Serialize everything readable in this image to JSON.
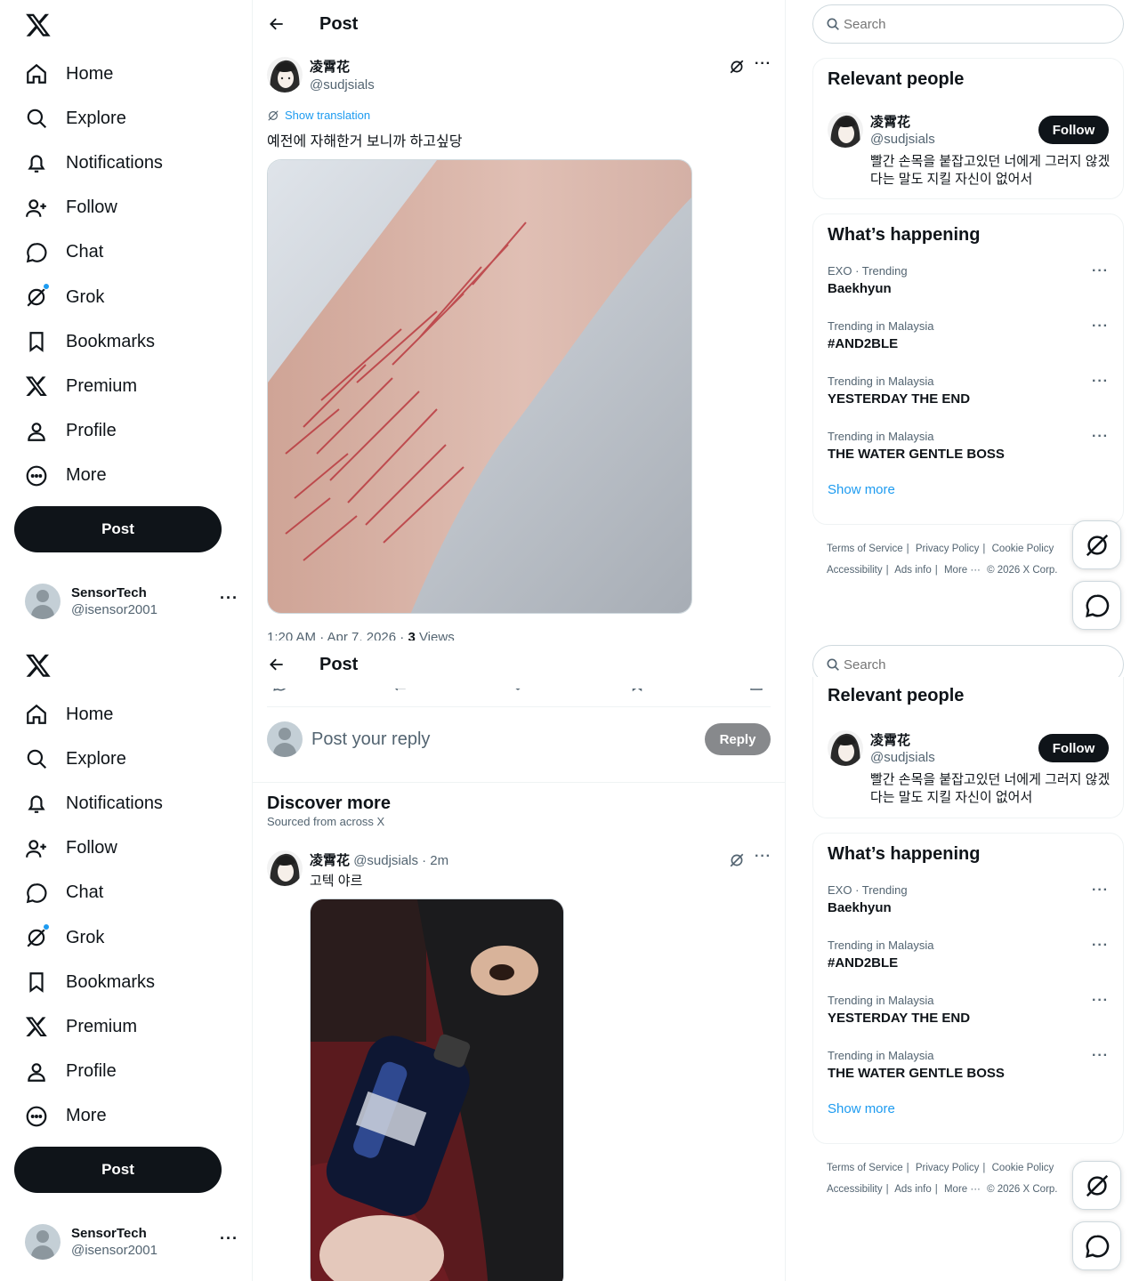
{
  "nav": {
    "items": [
      {
        "label": "Home"
      },
      {
        "label": "Explore"
      },
      {
        "label": "Notifications"
      },
      {
        "label": "Follow"
      },
      {
        "label": "Chat"
      },
      {
        "label": "Grok"
      },
      {
        "label": "Bookmarks"
      },
      {
        "label": "Premium"
      },
      {
        "label": "Profile"
      },
      {
        "label": "More"
      }
    ],
    "post_button": "Post"
  },
  "account": {
    "name": "SensorTech",
    "handle": "@isensor2001",
    "more": "···"
  },
  "header": {
    "title": "Post"
  },
  "post": {
    "author_name": "凌霄花",
    "author_handle": "@sudjsials",
    "show_translation": "Show translation",
    "text": "예전에 자해한거 보니까 하고싶당",
    "image_alt": "photo of a forearm with red scratches",
    "meta_time": "1:20 AM · Apr 7, 2026 · ",
    "meta_views": "3",
    "meta_views_label": " Views"
  },
  "reply": {
    "placeholder": "Post your reply",
    "button": "Reply"
  },
  "discover": {
    "title": "Discover more",
    "subtitle": "Sourced from across X",
    "post": {
      "author_name": "凌霄花",
      "author_handle": "@sudjsials",
      "time": "· 2m",
      "text": "고텍 야르"
    }
  },
  "search": {
    "placeholder": "Search"
  },
  "relevant": {
    "title": "Relevant people",
    "name": "凌霄花",
    "handle": "@sudjsials",
    "follow": "Follow",
    "bio": "빨간 손목을 붙잡고있던 너에게 그러지 않겠다는 말도 지킬 자신이 없어서"
  },
  "happening": {
    "title": "What’s happening",
    "trends": [
      {
        "category": "EXO · Trending",
        "name": "Baekhyun"
      },
      {
        "category": "Trending in Malaysia",
        "name": "#AND2BLE"
      },
      {
        "category": "Trending in Malaysia",
        "name": "YESTERDAY THE END"
      },
      {
        "category": "Trending in Malaysia",
        "name": "THE WATER GENTLE BOSS"
      }
    ],
    "show_more": "Show more"
  },
  "footer": {
    "tos": "Terms of Service",
    "privacy": "Privacy Policy",
    "cookie": "Cookie Policy",
    "accessibility": "Accessibility",
    "ads": "Ads info",
    "more": "More ···",
    "copyright": "© 2026 X Corp."
  },
  "colors": {
    "accent": "#1d9bf0",
    "text": "#0f1419",
    "muted": "#536471",
    "border": "#eff3f4"
  }
}
